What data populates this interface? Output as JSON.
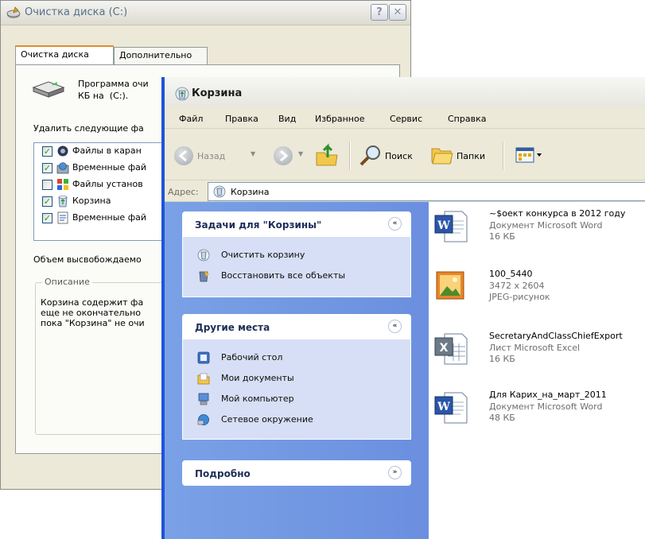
{
  "disk_cleanup": {
    "title": "Очистка диска  (C:)",
    "help_label": "?",
    "close_label": "✕",
    "tabs": [
      {
        "label": "Очистка диска"
      },
      {
        "label": "Дополнительно"
      }
    ],
    "intro_text": "Программа очи\nКБ на  (C:).",
    "delete_label": "Удалить следующие фа",
    "items": [
      {
        "label": "Файлы в каран",
        "checked": true,
        "icon": "quarantine-icon"
      },
      {
        "label": "Временные фай",
        "checked": true,
        "icon": "temp-internet-files-icon"
      },
      {
        "label": "Файлы установ",
        "checked": false,
        "icon": "setup-files-icon"
      },
      {
        "label": "Корзина",
        "checked": true,
        "icon": "recycle-bin-icon"
      },
      {
        "label": "Временные фай",
        "checked": true,
        "icon": "temp-files-icon"
      }
    ],
    "space_label": "Объем высвобождаемо",
    "description_legend": "Описание",
    "description_text": "Корзина содержит фа\nеще не окончательно\nпока \"Корзина\" не очи"
  },
  "recycle_bin": {
    "title": "Корзина",
    "menu": [
      "Файл",
      "Правка",
      "Вид",
      "Избранное",
      "Сервис",
      "Справка"
    ],
    "toolbar": {
      "back_label": "Назад",
      "search_label": "Поиск",
      "folders_label": "Папки"
    },
    "address_label": "Адрес:",
    "address_value": "Корзина",
    "task_panel": {
      "tasks_title": "Задачи для \"Корзины\"",
      "tasks": [
        {
          "label": "Очистить корзину",
          "icon": "empty-bin-icon"
        },
        {
          "label": "Восстановить все объекты",
          "icon": "restore-icon"
        }
      ],
      "places_title": "Другие места",
      "places": [
        {
          "label": "Рабочий стол",
          "icon": "desktop-icon"
        },
        {
          "label": "Мои документы",
          "icon": "my-documents-icon"
        },
        {
          "label": "Мой компьютер",
          "icon": "my-computer-icon"
        },
        {
          "label": "Сетевое окружение",
          "icon": "network-icon"
        }
      ],
      "details_title": "Подробно",
      "collapse_glyph": "«",
      "expand_glyph": "»"
    },
    "files": [
      {
        "name": "~$оект конкурса в 2012 году",
        "type": "Документ Microsoft Word",
        "size": "16 КБ",
        "icon": "word-document-icon"
      },
      {
        "name": "100_5440",
        "type": "3472 x 2604",
        "size": "JPEG-рисунок",
        "icon": "jpeg-image-icon"
      },
      {
        "name": "SecretaryAndClassChiefExport",
        "type": "Лист Microsoft Excel",
        "size": "16 КБ",
        "icon": "excel-sheet-icon"
      },
      {
        "name": "Для Карих_на_март_2011",
        "type": "Документ Microsoft Word",
        "size": "48 КБ",
        "icon": "word-document-icon"
      }
    ]
  },
  "colors": {
    "xp_blue": "#1f53d8",
    "task_pane": "#7aa1e6",
    "task_body": "#d6dff5",
    "check_green": "#21a121"
  }
}
